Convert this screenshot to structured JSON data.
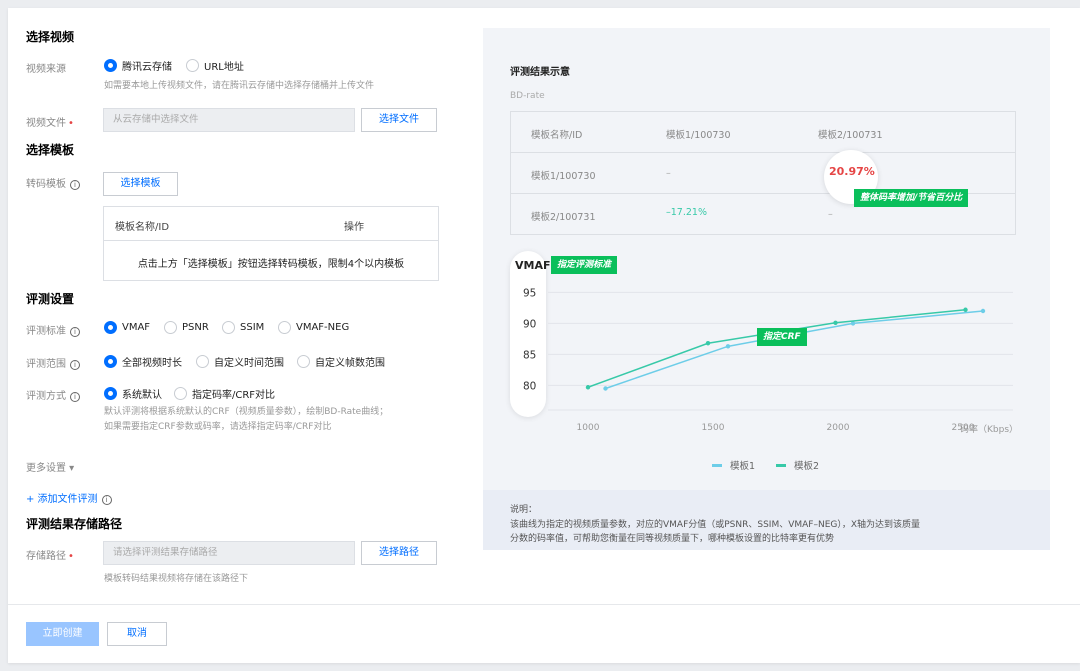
{
  "sections": {
    "select_video": "选择视频",
    "select_template": "选择模板",
    "eval_settings": "评测设置",
    "storage_path": "评测结果存储路径"
  },
  "video_source": {
    "label": "视频来源",
    "options": [
      "腾讯云存储",
      "URL地址"
    ],
    "hint": "如需要本地上传视频文件，请在腾讯云存储中选择存储桶并上传文件"
  },
  "video_file": {
    "label": "视频文件",
    "placeholder": "从云存储中选择文件",
    "button": "选择文件"
  },
  "transcode_template": {
    "label": "转码模板",
    "button": "选择模板",
    "table_headers": [
      "模板名称/ID",
      "操作"
    ],
    "empty_text": "点击上方「选择模板」按钮选择转码模板，限制4个以内模板"
  },
  "eval_standard": {
    "label": "评测标准",
    "options": [
      "VMAF",
      "PSNR",
      "SSIM",
      "VMAF-NEG"
    ]
  },
  "eval_range": {
    "label": "评测范围",
    "options": [
      "全部视频时长",
      "自定义时间范围",
      "自定义帧数范围"
    ]
  },
  "eval_method": {
    "label": "评测方式",
    "options": [
      "系统默认",
      "指定码率/CRF对比"
    ],
    "hint_line1": "默认评测将根据系统默认的CRF（视频质量参数），绘制BD-Rate曲线；",
    "hint_line2": "如果需要指定CRF参数或码率，请选择指定码率/CRF对比"
  },
  "more_settings": "更多设置 ▾",
  "add_file_eval": "+ 添加文件评测",
  "storage": {
    "label": "存储路径",
    "placeholder": "请选择评测结果存储路径",
    "button": "选择路径",
    "hint": "模板转码结果视频将存储在该路径下"
  },
  "footer": {
    "create": "立即创建",
    "cancel": "取消"
  },
  "panel": {
    "title": "评测结果示意",
    "subtitle": "BD-rate",
    "bd_table": {
      "headers": [
        "模板名称/ID",
        "模板1/100730",
        "模板2/100731"
      ],
      "rows": [
        [
          "模板1/100730",
          "–",
          "20.97%"
        ],
        [
          "模板2/100731",
          "–17.21%",
          "–"
        ]
      ]
    },
    "tag_bitrate": "整体码率增加/节省百分比",
    "tag_standard": "指定评测标准",
    "tag_crf": "指定CRF",
    "desc_title": "说明：",
    "desc_line1": "该曲线为指定的视频质量参数，对应的VMAF分值（或PSNR、SSIM、VMAF–NEG），X轴为达到该质量",
    "desc_line2": "分数的码率值，可帮助您衡量在同等视频质量下，哪种模板设置的比特率更有优势"
  },
  "chart_data": {
    "type": "line",
    "ylabel": "VMAF",
    "xlabel": "码率（Kbps）",
    "x_ticks": [
      1000,
      1500,
      2000,
      2500
    ],
    "y_ticks": [
      95,
      90,
      85,
      80
    ],
    "xlim": [
      900,
      2700
    ],
    "ylim": [
      77,
      97
    ],
    "series": [
      {
        "name": "模板1",
        "color": "#6dcde8",
        "x": [
          1070,
          1560,
          2060,
          2580
        ],
        "y": [
          79.5,
          86.3,
          90.0,
          92.0
        ]
      },
      {
        "name": "模板2",
        "color": "#37c9a8",
        "x": [
          1000,
          1480,
          1990,
          2510
        ],
        "y": [
          79.7,
          86.8,
          90.1,
          92.2
        ]
      }
    ],
    "legend": "bottom"
  }
}
